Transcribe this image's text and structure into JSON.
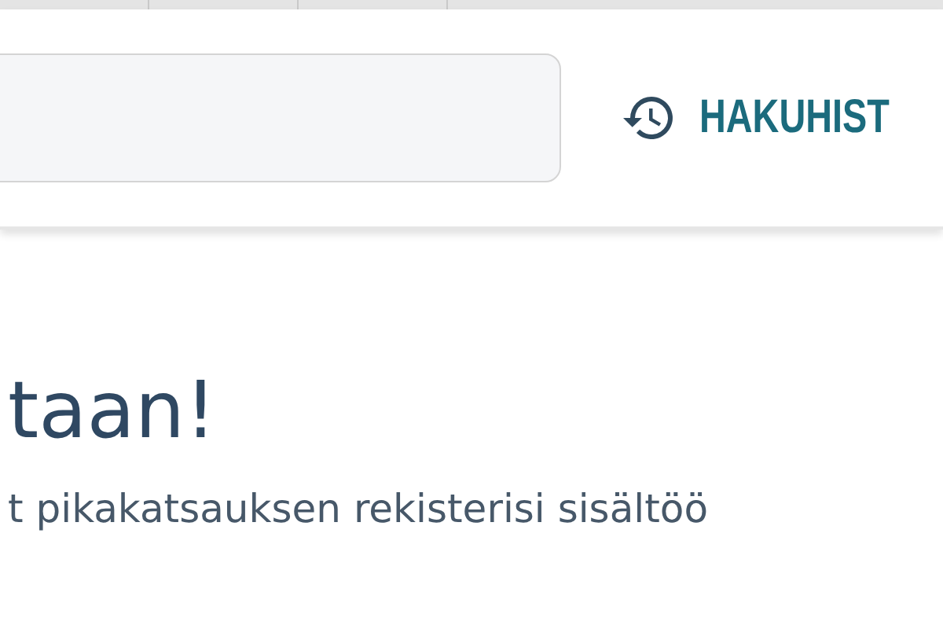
{
  "history_button": {
    "label": "HAKUHIST"
  },
  "welcome": {
    "heading": "taan!",
    "text": "t pikakatsauksen rekisterisi sisältöö"
  }
}
